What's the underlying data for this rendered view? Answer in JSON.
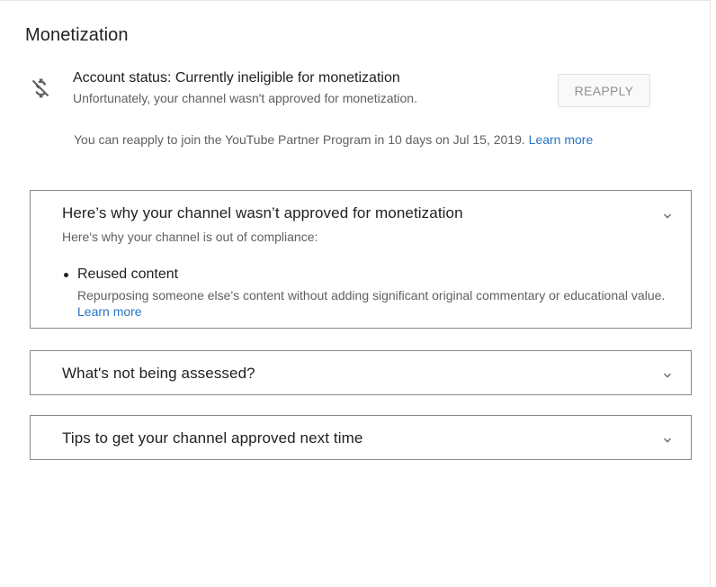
{
  "section": {
    "title": "Monetization"
  },
  "status": {
    "icon": "money-off-icon",
    "title": "Account status: Currently ineligible for monetization",
    "subtitle": "Unfortunately, your channel wasn't approved for monetization.",
    "reapply_label": "REAPPLY",
    "note": "You can reapply to join the YouTube Partner Program in 10 days on Jul 15, 2019.",
    "note_link": "Learn more"
  },
  "panels": [
    {
      "title": "Here’s why your channel wasn’t approved for monetization",
      "expanded": true,
      "description": "Here's why your channel is out of compliance:",
      "items": [
        {
          "title": "Reused content",
          "body": "Repurposing someone else's content without adding significant original commentary or educational value.",
          "link": "Learn more"
        }
      ]
    },
    {
      "title": "What's not being assessed?",
      "expanded": false
    },
    {
      "title": "Tips to get your channel approved next time",
      "expanded": false
    }
  ],
  "colors": {
    "link": "#2874c4",
    "text_primary": "#212121",
    "text_secondary": "#606060",
    "panel_border": "#8a8a8a"
  }
}
